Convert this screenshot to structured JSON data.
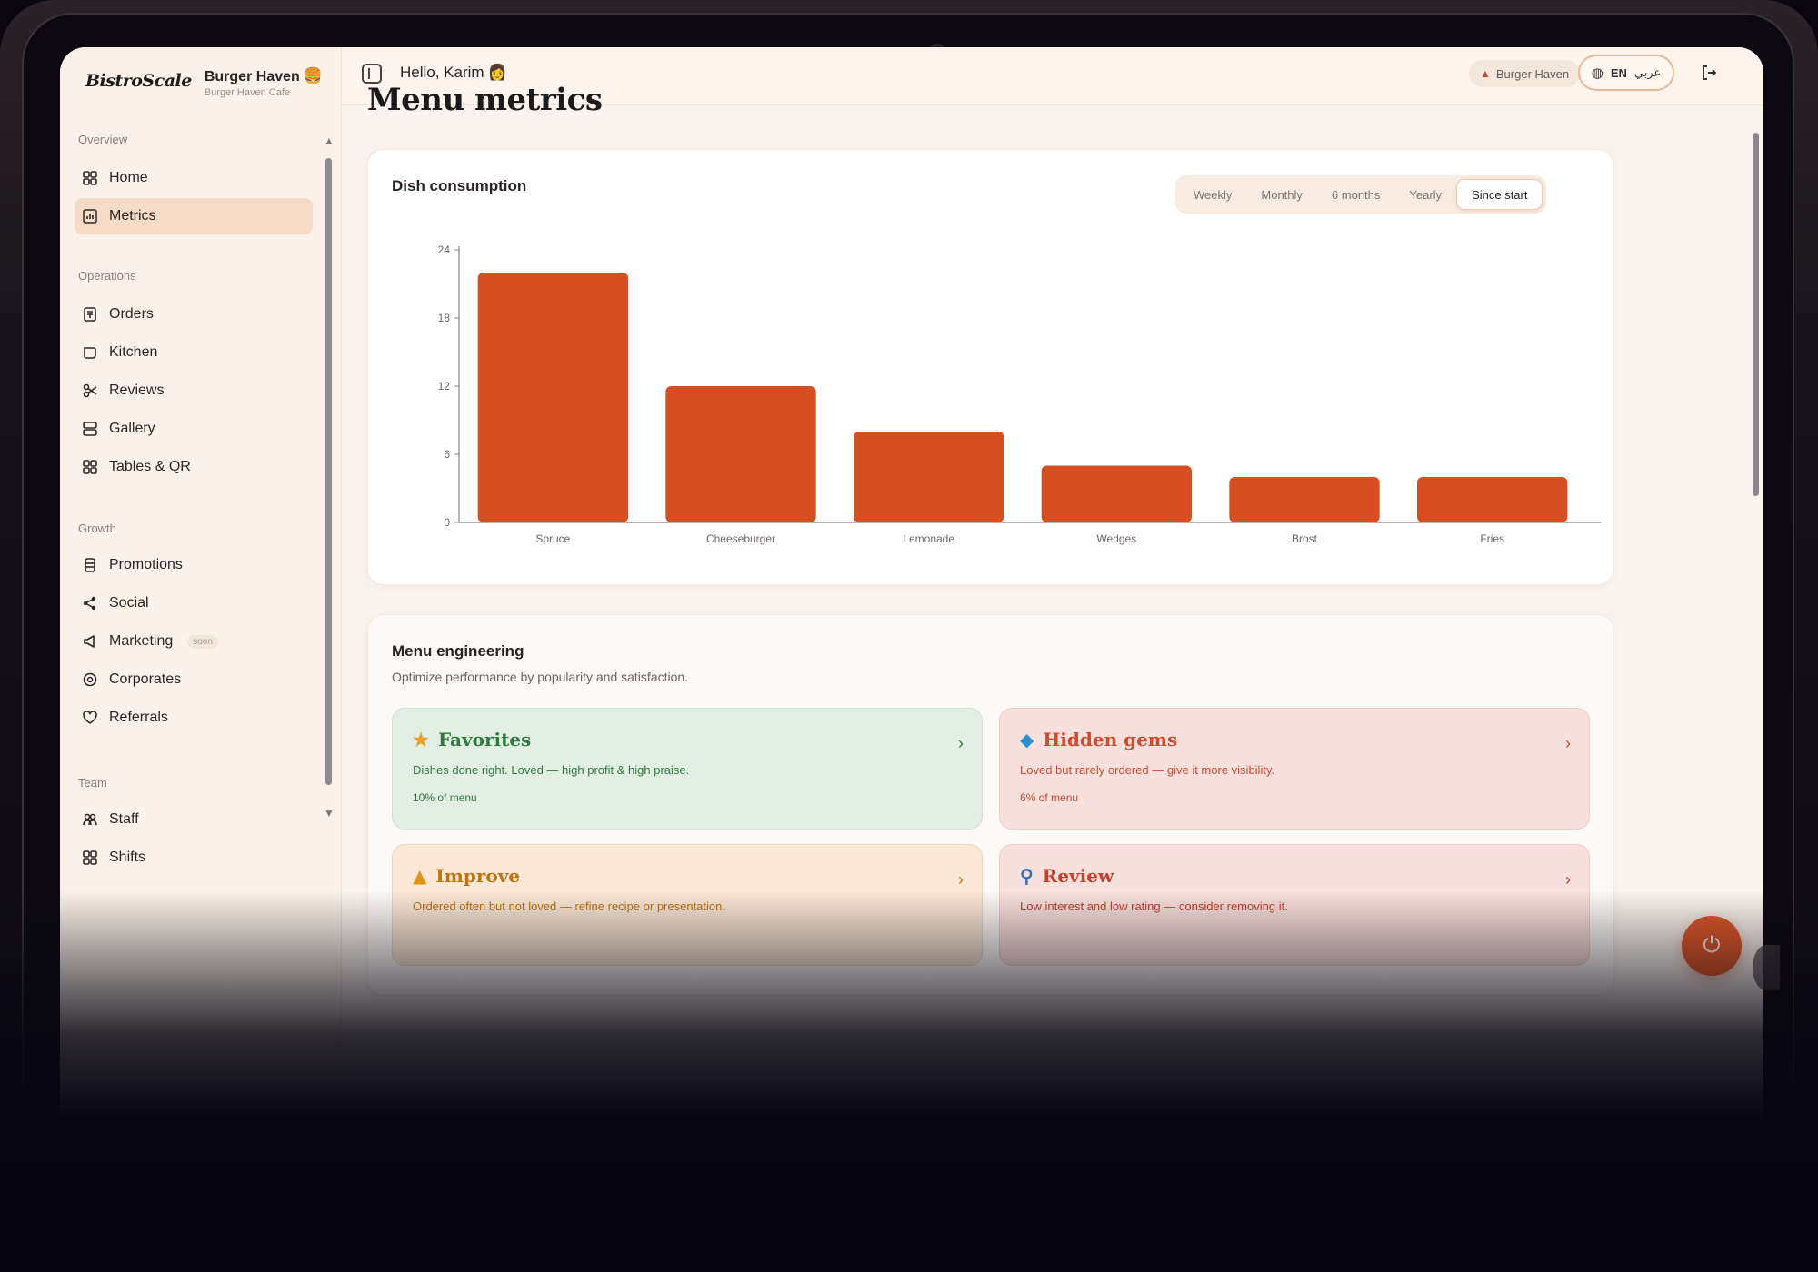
{
  "brand": {
    "logo": "BistroScale",
    "restaurant": "Burger Haven",
    "restaurant_sub": "Burger Haven Cafe",
    "emoji": "🍔"
  },
  "sidebar": {
    "sections": [
      {
        "label": "Overview",
        "items": [
          {
            "label": "Home",
            "icon": "grid-icon"
          },
          {
            "label": "Metrics",
            "icon": "chart-icon",
            "active": true
          }
        ]
      },
      {
        "label": "Operations",
        "items": [
          {
            "label": "Orders",
            "icon": "orders-icon"
          },
          {
            "label": "Kitchen",
            "icon": "kitchen-icon"
          },
          {
            "label": "Reviews",
            "icon": "reviews-icon"
          },
          {
            "label": "Gallery",
            "icon": "gallery-icon"
          },
          {
            "label": "Tables & QR",
            "icon": "qr-icon"
          }
        ]
      },
      {
        "label": "Growth",
        "items": [
          {
            "label": "Promotions",
            "icon": "promotions-icon"
          },
          {
            "label": "Social",
            "icon": "share-icon"
          },
          {
            "label": "Marketing",
            "icon": "megaphone-icon",
            "badge": "soon"
          },
          {
            "label": "Corporates",
            "icon": "corporates-icon"
          },
          {
            "label": "Referrals",
            "icon": "referrals-icon"
          }
        ]
      },
      {
        "label": "Team",
        "items": [
          {
            "label": "Staff",
            "icon": "staff-icon"
          },
          {
            "label": "Shifts",
            "icon": "shifts-icon"
          }
        ]
      }
    ]
  },
  "topbar": {
    "greeting": "Hello, Karim",
    "greeting_emoji": "👩",
    "restaurant_pill": "Burger Haven",
    "lang": "EN",
    "lang_alt": "عربي"
  },
  "page": {
    "title": "Menu metrics"
  },
  "consumption": {
    "title": "Dish consumption",
    "periods": [
      "Weekly",
      "Monthly",
      "6 months",
      "Yearly",
      "Since start"
    ],
    "active_period": "Since start"
  },
  "chart_data": {
    "type": "bar",
    "title": "Dish consumption",
    "categories": [
      "Spruce",
      "Cheeseburger",
      "Lemonade",
      "Wedges",
      "Brost",
      "Fries"
    ],
    "values": [
      22,
      12,
      8,
      5,
      4,
      4
    ],
    "ylim": [
      0,
      24
    ],
    "yticks": [
      0,
      6,
      12,
      18,
      24
    ],
    "color": "#d64f23",
    "grid": false
  },
  "engineering": {
    "title": "Menu engineering",
    "subtitle": "Optimize performance by popularity and satisfaction.",
    "quadrants": [
      {
        "title": "Favorites",
        "icon": "star-icon",
        "desc": "Dishes done right. Loved — high profit & high praise.",
        "share": "10% of menu"
      },
      {
        "title": "Hidden gems",
        "icon": "gem-icon",
        "desc": "Loved but rarely ordered — give it more visibility.",
        "share": "6% of menu"
      },
      {
        "title": "Improve",
        "icon": "warning-icon",
        "desc": "Ordered often but not loved — refine recipe or presentation."
      },
      {
        "title": "Review",
        "icon": "magnifier-icon",
        "desc": "Low interest and low rating — consider removing it."
      }
    ]
  }
}
